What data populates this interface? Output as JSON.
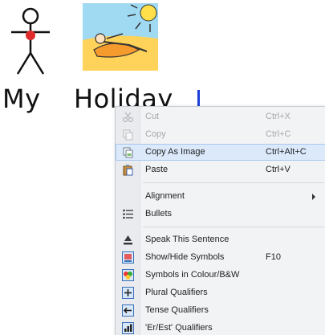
{
  "document": {
    "words": [
      "My",
      "Holiday"
    ],
    "symbols": [
      "person-me-icon",
      "beach-holiday-icon"
    ]
  },
  "menu": {
    "items": [
      {
        "label": "Cut",
        "shortcut": "Ctrl+X",
        "icon": "scissors-icon",
        "enabled": false
      },
      {
        "label": "Copy",
        "shortcut": "Ctrl+C",
        "icon": "copy-icon",
        "enabled": false
      },
      {
        "label": "Copy As Image",
        "shortcut": "Ctrl+Alt+C",
        "icon": "copy-image-icon",
        "enabled": true,
        "highlighted": true
      },
      {
        "label": "Paste",
        "shortcut": "Ctrl+V",
        "icon": "paste-icon",
        "enabled": true
      },
      {
        "label": "Alignment",
        "shortcut": "",
        "icon": "",
        "enabled": true,
        "submenu": true
      },
      {
        "label": "Bullets",
        "shortcut": "",
        "icon": "bullets-icon",
        "enabled": true
      },
      {
        "label": "Speak This Sentence",
        "shortcut": "",
        "icon": "speak-icon",
        "enabled": true
      },
      {
        "label": "Show/Hide Symbols",
        "shortcut": "F10",
        "icon": "symbols-toggle-icon",
        "enabled": true
      },
      {
        "label": "Symbols in Colour/B&W",
        "shortcut": "",
        "icon": "colour-icon",
        "enabled": true
      },
      {
        "label": "Plural Qualifiers",
        "shortcut": "",
        "icon": "plural-icon",
        "enabled": true
      },
      {
        "label": "Tense Qualifiers",
        "shortcut": "",
        "icon": "tense-icon",
        "enabled": true
      },
      {
        "label": "'Er/Est' Qualifiers",
        "shortcut": "",
        "icon": "comparative-icon",
        "enabled": true
      }
    ]
  },
  "colors": {
    "caret": "#1a3fd9",
    "highlight": "#dbe9fb",
    "menu_bg": "#f2f3f5"
  }
}
